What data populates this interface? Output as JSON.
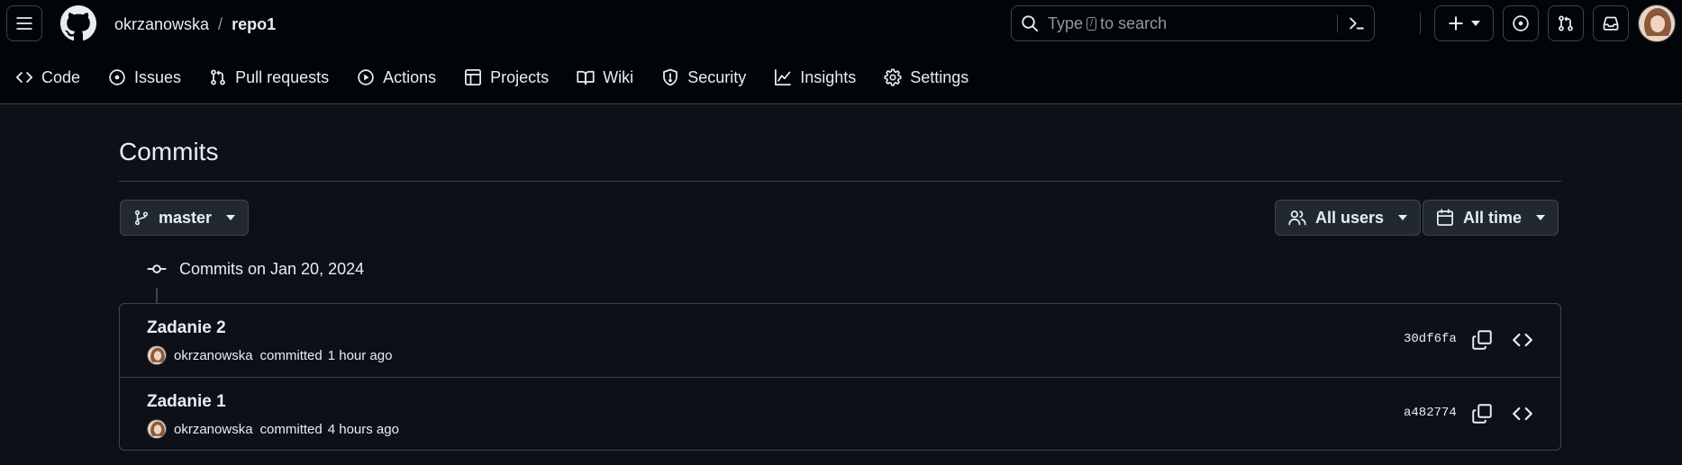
{
  "header": {
    "owner": "okrzanowska",
    "separator": "/",
    "repo": "repo1",
    "search": {
      "prefix": "Type",
      "key": "/",
      "suffix": "to search"
    },
    "icons": [
      "hamburger-menu-icon",
      "github-logo-icon",
      "search-icon",
      "command-palette-icon",
      "plus-icon",
      "issues-icon",
      "pull-requests-icon",
      "inbox-icon"
    ]
  },
  "tabs": [
    {
      "label": "Code",
      "icon": "code-icon"
    },
    {
      "label": "Issues",
      "icon": "issue-opened-icon"
    },
    {
      "label": "Pull requests",
      "icon": "git-pull-request-icon"
    },
    {
      "label": "Actions",
      "icon": "play-icon"
    },
    {
      "label": "Projects",
      "icon": "table-icon"
    },
    {
      "label": "Wiki",
      "icon": "book-icon"
    },
    {
      "label": "Security",
      "icon": "shield-icon"
    },
    {
      "label": "Insights",
      "icon": "graph-icon"
    },
    {
      "label": "Settings",
      "icon": "gear-icon"
    }
  ],
  "main": {
    "title": "Commits",
    "branch": "master",
    "user_filter": "All users",
    "time_filter": "All time",
    "day_header": "Commits on Jan 20, 2024",
    "commits": [
      {
        "title": "Zadanie 2",
        "author": "okrzanowska",
        "action": "committed",
        "time": "1 hour ago",
        "sha": "30df6fa"
      },
      {
        "title": "Zadanie 1",
        "author": "okrzanowska",
        "action": "committed",
        "time": "4 hours ago",
        "sha": "a482774"
      }
    ]
  },
  "colors": {
    "header_bg": "#010409",
    "page_bg": "#0d1117",
    "border": "#3d444d",
    "text": "#e6edf3",
    "muted": "#9198a1",
    "button_bg": "#212830"
  }
}
